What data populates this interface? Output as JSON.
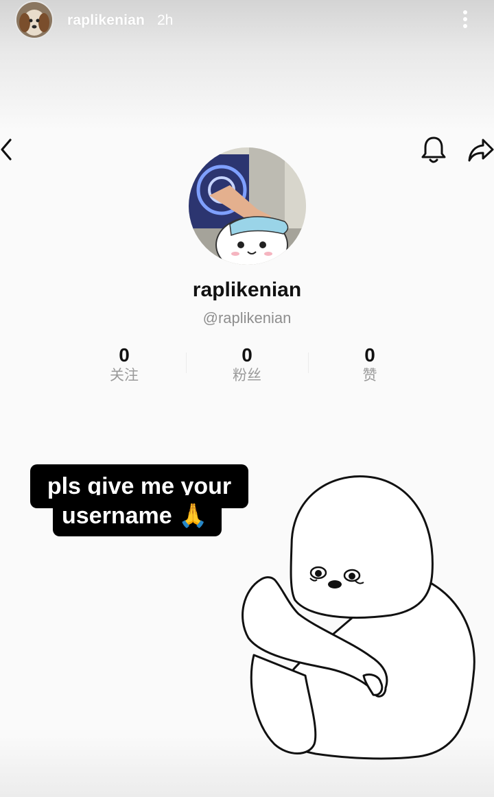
{
  "story": {
    "username": "raplikenian",
    "time": "2h",
    "more_icon": "more-vertical-icon"
  },
  "profile_nav": {
    "back_icon": "chevron-left-icon",
    "bell_icon": "bell-icon",
    "share_icon": "share-arrow-icon"
  },
  "profile": {
    "name": "raplikenian",
    "handle": "@raplikenian",
    "stats": [
      {
        "value": "0",
        "label": "关注"
      },
      {
        "value": "0",
        "label": "粉丝"
      },
      {
        "value": "0",
        "label": "赞"
      }
    ]
  },
  "caption": {
    "line1": "pls give me your",
    "line2": "username 🙏"
  },
  "colors": {
    "background": "#fafafa",
    "caption_bg": "#000000",
    "caption_text": "#ffffff",
    "muted_text": "#8e8e8e"
  }
}
